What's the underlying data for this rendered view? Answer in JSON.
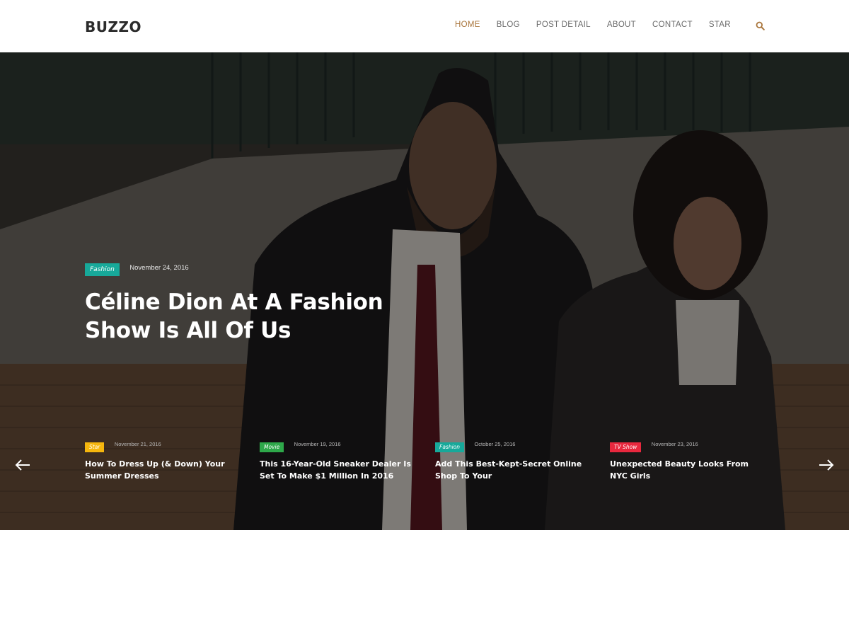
{
  "header": {
    "logo": "BUZZO",
    "nav": [
      "HOME",
      "BLOG",
      "POST DETAIL",
      "ABOUT",
      "CONTACT",
      "STAR"
    ],
    "active_nav": "HOME",
    "search_icon": "search-icon"
  },
  "hero": {
    "featured": {
      "category": "Fashion",
      "date": "November 24, 2016",
      "title": "Céline Dion At A Fashion Show Is All Of Us"
    },
    "cards": [
      {
        "category": "Star",
        "category_color": "#f5b60d",
        "date": "November 21, 2016",
        "title": "How To Dress Up (& Down) Your Summer Dresses"
      },
      {
        "category": "Movie",
        "category_color": "#2ea84a",
        "date": "November 19, 2016",
        "title": "This 16-Year-Old Sneaker Dealer Is Set To Make $1 Million In 2016"
      },
      {
        "category": "Fashion",
        "category_color": "#17a99a",
        "date": "October 25, 2016",
        "title": "Add This Best-Kept-Secret Online Shop To Your"
      },
      {
        "category": "TV Show",
        "category_color": "#e8283e",
        "date": "November 23, 2016",
        "title": "Unexpected Beauty Looks From NYC Girls"
      }
    ],
    "prev_icon": "arrow-left-icon",
    "next_icon": "arrow-right-icon"
  },
  "colors": {
    "accent": "#a9753b",
    "fashion": "#17a99a"
  }
}
